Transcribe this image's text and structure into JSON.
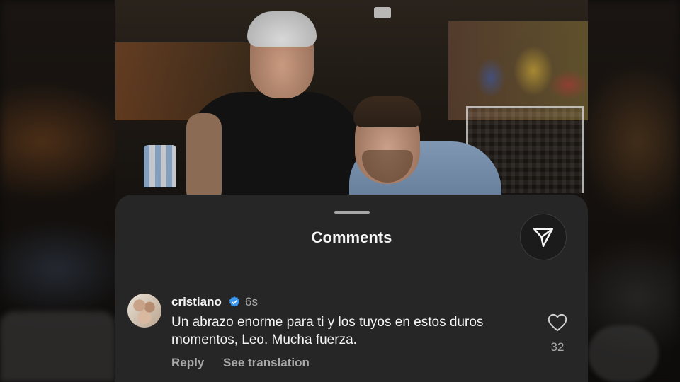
{
  "sheet": {
    "title": "Comments",
    "share_icon": "send-icon"
  },
  "comment": {
    "username": "cristiano",
    "verified": true,
    "time": "6s",
    "text": "Un abrazo enorme para ti y los tuyos en estos duros momentos, Leo. Mucha fuerza.",
    "reply_label": "Reply",
    "translate_label": "See translation",
    "like_icon": "heart-icon",
    "like_count": "32"
  },
  "colors": {
    "sheet_bg": "#262626",
    "verified": "#3897f0",
    "muted": "#a8a8a8"
  }
}
